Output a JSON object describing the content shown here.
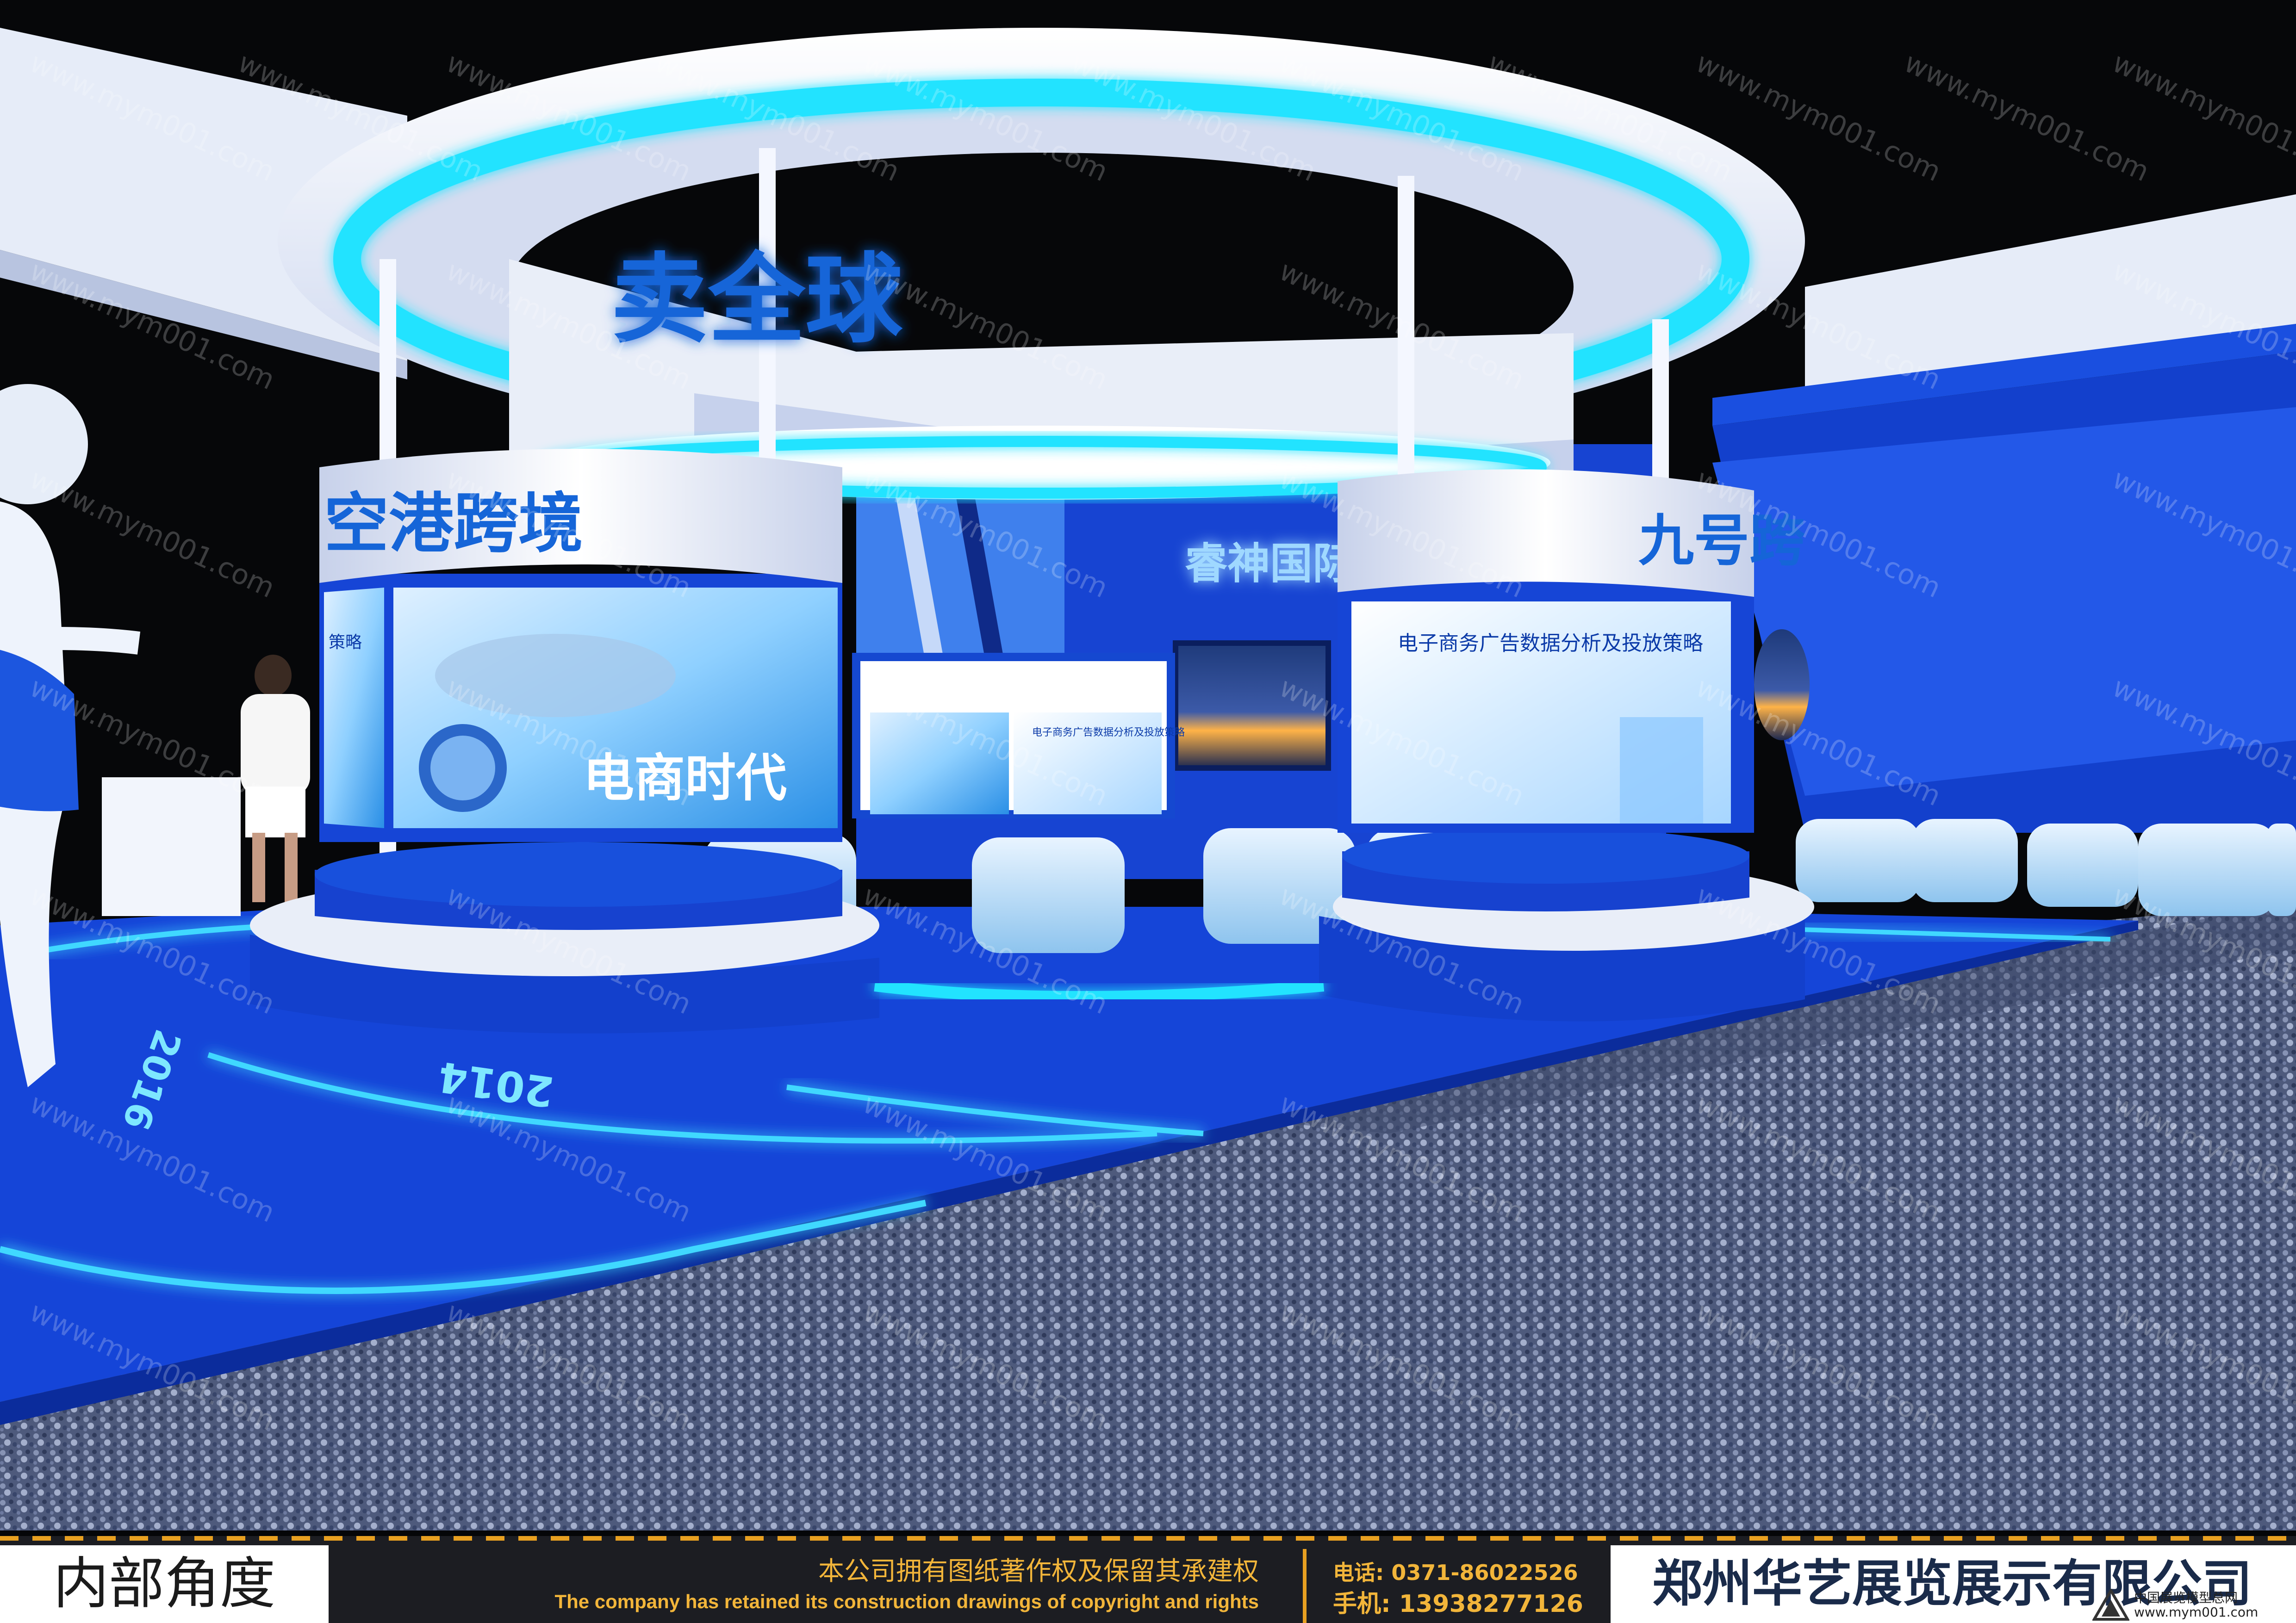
{
  "booth": {
    "top_sign": "卖全球",
    "left_drum_sign": "空港跨境",
    "right_drum_sign": "九号跨",
    "back_wall_sign": "睿神国际",
    "left_screen_text": "电商时代",
    "right_screen_title": "电子商务广告数据分析及投放策略",
    "small_screen_title": "电子商务广告数据分析及投放策略",
    "left_screen_edge_text": "策略",
    "floor_text_left": "2016",
    "floor_text_center": "2014"
  },
  "watermark": "www.mym001.com",
  "footer": {
    "view_label": "内部角度",
    "copyright_cn": "本公司拥有图纸著作权及保留其承建权",
    "copyright_en": "The company has retained its construction drawings of copyright and rights",
    "phone": "电话: 0371-86022526",
    "mobile": "手机: 13938277126",
    "company": "郑州华艺展览展示有限公司",
    "logo_cn": "中国展览模型总网",
    "logo_url": "www.mym001.com"
  },
  "colors": {
    "booth_blue": "#1443d6",
    "glow_cyan": "#1ee0ff",
    "white_structure": "#e9eef8",
    "carpet": "#5a6688",
    "footer_accent": "#e8a021"
  }
}
